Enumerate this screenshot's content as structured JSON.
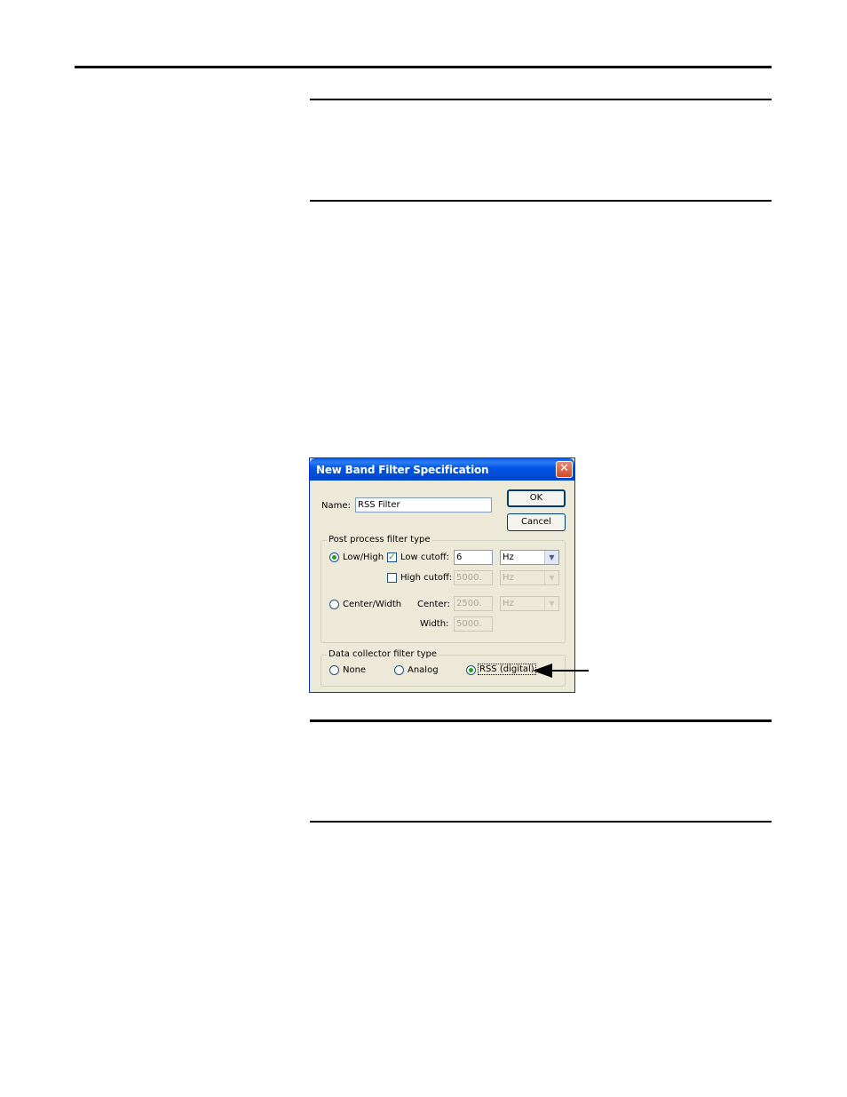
{
  "dialog": {
    "title": "New Band Filter Specification",
    "name_label": "Name:",
    "name_value": "RSS Filter",
    "ok_label": "OK",
    "cancel_label": "Cancel",
    "post_process": {
      "group_label": "Post process filter type",
      "lowhigh_label": "Low/High",
      "low_cutoff_label": "Low cutoff:",
      "low_cutoff_value": "6",
      "low_cutoff_unit": "Hz",
      "high_cutoff_label": "High cutoff:",
      "high_cutoff_value": "5000.",
      "high_cutoff_unit": "Hz",
      "centerwidth_label": "Center/Width",
      "center_label": "Center:",
      "center_value": "2500.",
      "center_unit": "Hz",
      "width_label": "Width:",
      "width_value": "5000."
    },
    "collector": {
      "group_label": "Data collector filter type",
      "none_label": "None",
      "analog_label": "Analog",
      "rss_label": "RSS (digital)"
    }
  },
  "colors": {
    "titlebar": "#0054e3",
    "dialog_bg": "#ece9d8",
    "close": "#cf4b2a"
  }
}
